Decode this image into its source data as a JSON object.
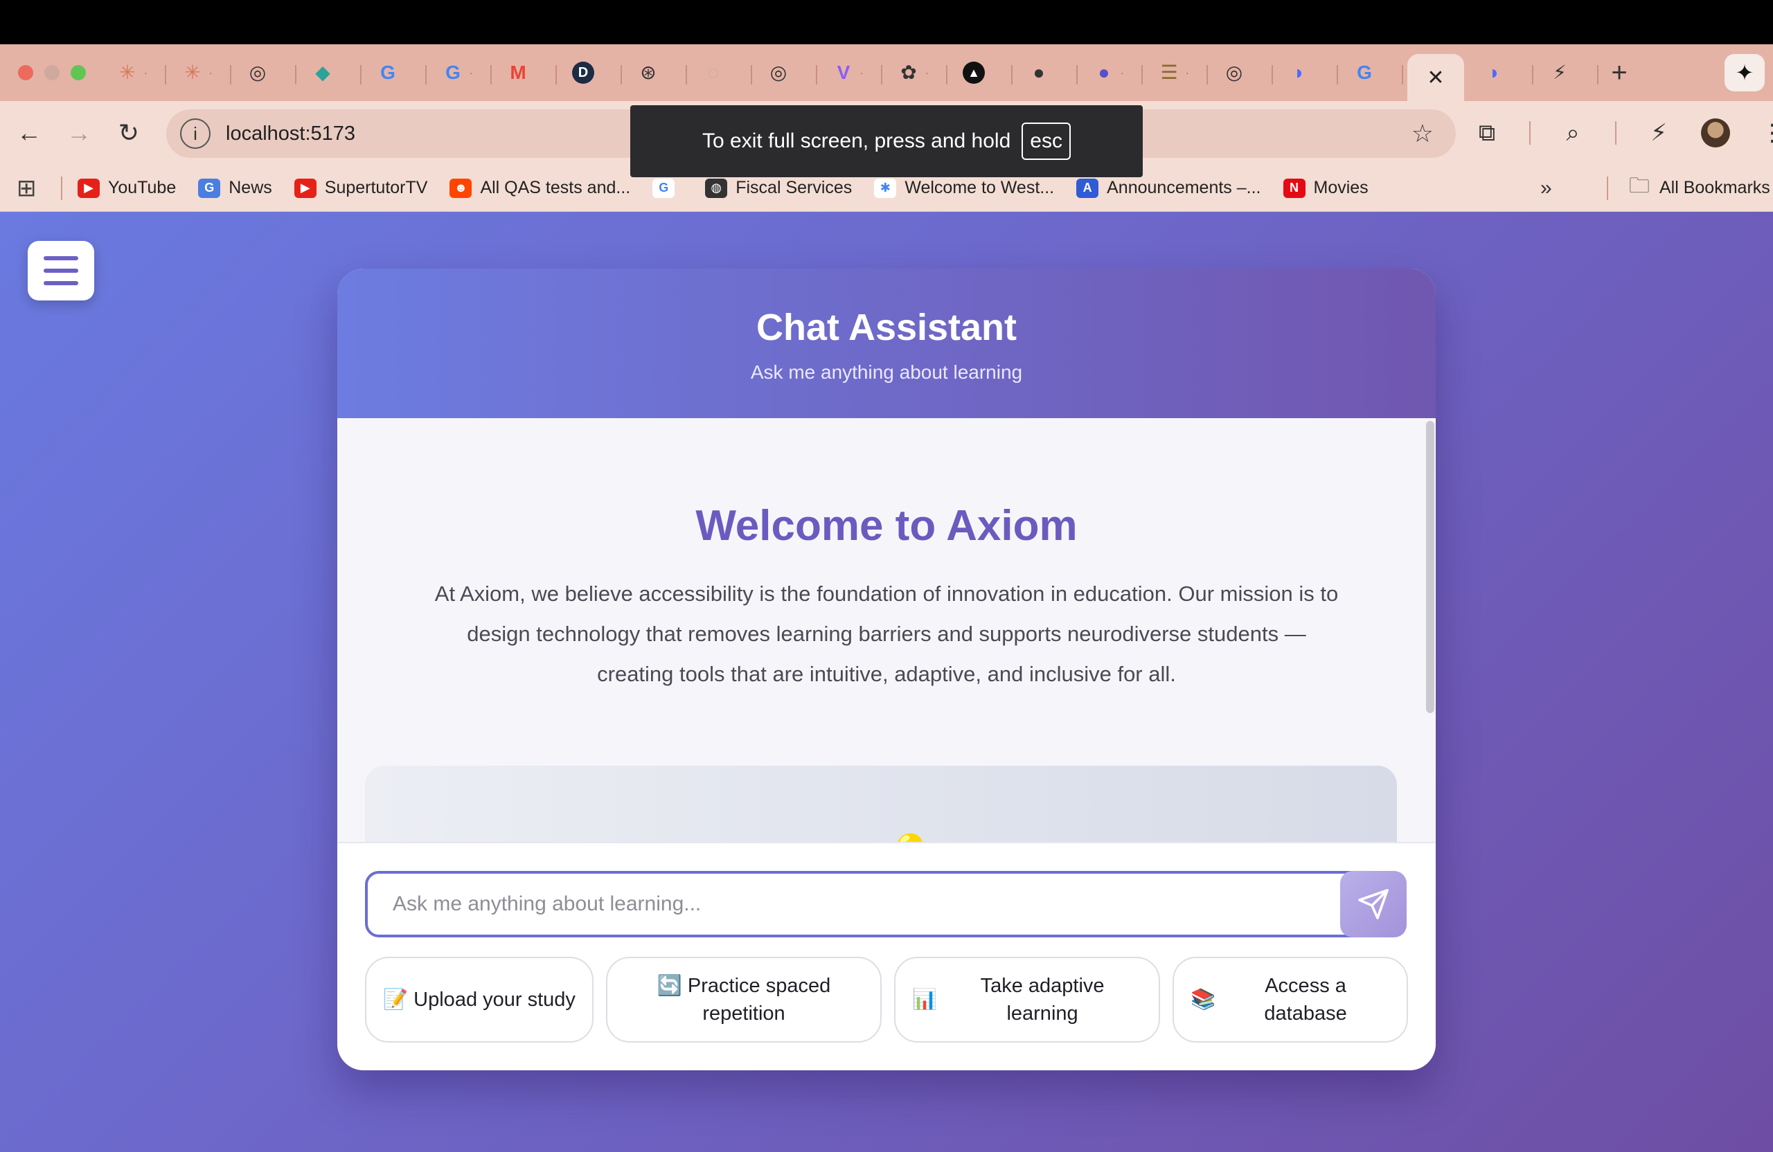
{
  "browser": {
    "tabs": [
      {
        "icon": "claude-icon"
      },
      {
        "icon": "claude-icon"
      },
      {
        "icon": "chrome-icon"
      },
      {
        "icon": "diamond-icon"
      },
      {
        "icon": "google-icon"
      },
      {
        "icon": "google-icon"
      },
      {
        "icon": "gmail-icon"
      },
      {
        "icon": "d-icon"
      },
      {
        "icon": "seal-icon"
      },
      {
        "icon": "blank-icon"
      },
      {
        "icon": "chrome-icon"
      },
      {
        "icon": "vite-icon"
      },
      {
        "icon": "openai-icon"
      },
      {
        "icon": "triangle-icon"
      },
      {
        "icon": "github-icon"
      },
      {
        "icon": "github-icon"
      },
      {
        "icon": "stack-icon"
      },
      {
        "icon": "chrome-icon"
      },
      {
        "icon": "whale-icon"
      },
      {
        "icon": "google-icon"
      }
    ],
    "active_tab_close": "✕",
    "new_tab": "+",
    "url": "localhost:5173",
    "fullscreen_toast": {
      "text": "To exit full screen, press and hold",
      "key": "esc"
    },
    "bookmarks": [
      {
        "label": "YouTube",
        "color": "#e62117",
        "glyph": "▶"
      },
      {
        "label": "News",
        "color": "#4a7fe0",
        "glyph": "G"
      },
      {
        "label": "SupertutorTV",
        "color": "#e62117",
        "glyph": "▶"
      },
      {
        "label": "All QAS tests and...",
        "color": "#ff4500",
        "glyph": "☻"
      },
      {
        "label": "",
        "color": "#ffffff",
        "glyph": "G"
      },
      {
        "label": "Fiscal Services",
        "color": "#333333",
        "glyph": "◍"
      },
      {
        "label": "Welcome to West...",
        "color": "#ffffff",
        "glyph": "✱"
      },
      {
        "label": "Announcements –...",
        "color": "#2f5bd6",
        "glyph": "A"
      },
      {
        "label": "Movies",
        "color": "#e50914",
        "glyph": "N"
      }
    ],
    "bookmarks_more": "»",
    "all_bookmarks": "All Bookmarks"
  },
  "app": {
    "title": "Chat Assistant",
    "subtitle": "Ask me anything about learning",
    "welcome_title": "Welcome to Axiom",
    "welcome_text": "At Axiom, we believe accessibility is the foundation of innovation in education. Our mission is to design technology that removes learning barriers and supports neurodiverse students — creating tools that are intuitive, adaptive, and inclusive for all.",
    "input_placeholder": "Ask me anything about learning...",
    "chips": [
      {
        "emoji": "📝",
        "label": "Upload your study"
      },
      {
        "emoji": "🔄",
        "label": "Practice spaced repetition"
      },
      {
        "emoji": "📊",
        "label": "Take adaptive learning"
      },
      {
        "emoji": "📚",
        "label": "Access a database"
      }
    ],
    "accent": "#6a5bc0"
  }
}
